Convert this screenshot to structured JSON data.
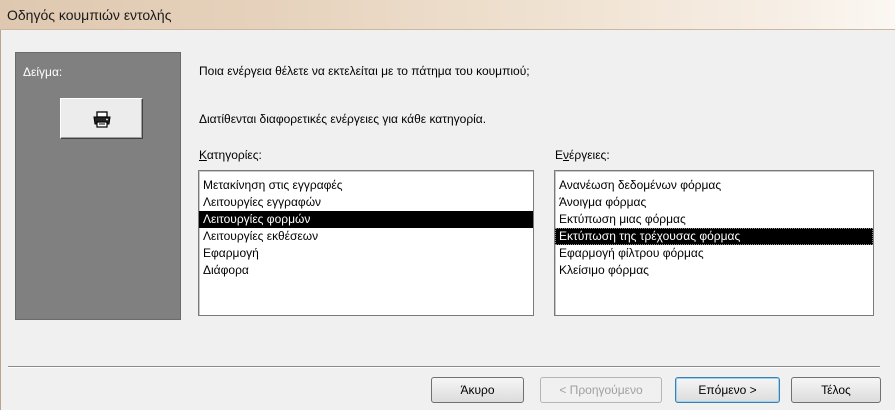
{
  "window": {
    "title": "Οδηγός κουμπιών εντολής"
  },
  "sample": {
    "label": "Δείγμα:",
    "button_icon": "printer-icon"
  },
  "question": "Ποια ενέργεια θέλετε να εκτελείται με το πάτημα του κουμπιού;",
  "hint": "Διατίθενται διαφορετικές ενέργειες για κάθε κατηγορία.",
  "categories": {
    "label": "Κατηγορίες:",
    "items": [
      "Μετακίνηση στις εγγραφές",
      "Λειτουργίες εγγραφών",
      "Λειτουργίες φορμών",
      "Λειτουργίες εκθέσεων",
      "Εφαρμογή",
      "Διάφορα"
    ],
    "selected": "Λειτουργίες φορμών"
  },
  "actions": {
    "label": "Ενέργειες:",
    "items": [
      "Ανανέωση δεδομένων φόρμας",
      "Άνοιγμα φόρμας",
      "Εκτύπωση μιας φόρμας",
      "Εκτύπωση της τρέχουσας φόρμας",
      "Εφαρμογή φίλτρου φόρμας",
      "Κλείσιμο φόρμας"
    ],
    "selected": "Εκτύπωση της τρέχουσας φόρμας"
  },
  "buttons": {
    "cancel": "Άκυρο",
    "back": "< Προηγούμενο",
    "next": "Επόμενο >",
    "finish": "Τέλος"
  }
}
